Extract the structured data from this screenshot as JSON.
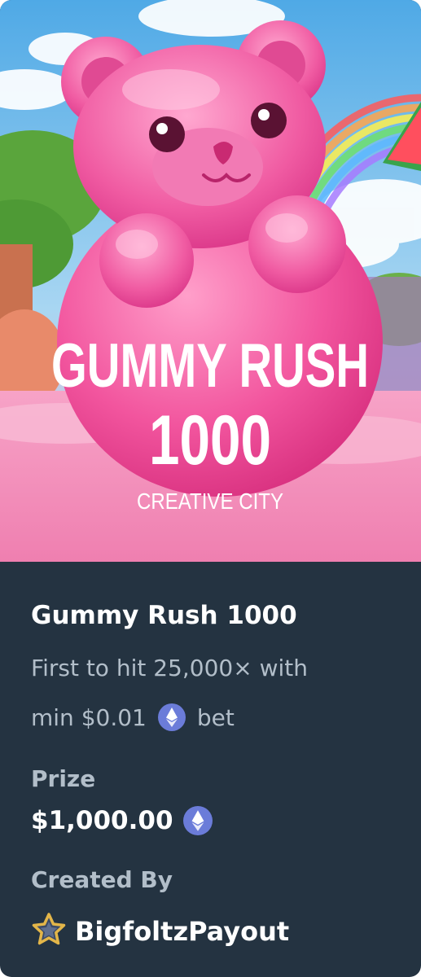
{
  "game": {
    "banner_title_line1": "GUMMY RUSH",
    "banner_title_line2": "1000",
    "banner_studio": "CREATIVE CITY",
    "title": "Gummy Rush 1000",
    "description_line1": "First to hit 25,000× with",
    "description_min": "min $0.01",
    "description_bet": "bet",
    "currency_icon": "ethereum-icon"
  },
  "prize": {
    "label": "Prize",
    "value": "$1,000.00"
  },
  "creator": {
    "label": "Created By",
    "name": "BigfoltzPayout",
    "badge_icon": "star-badge-icon"
  },
  "colors": {
    "card_bg": "#243341",
    "muted_text": "#b2bec9",
    "eth_blue": "#6b7cd9",
    "banner_pink": "#f06aa8"
  }
}
